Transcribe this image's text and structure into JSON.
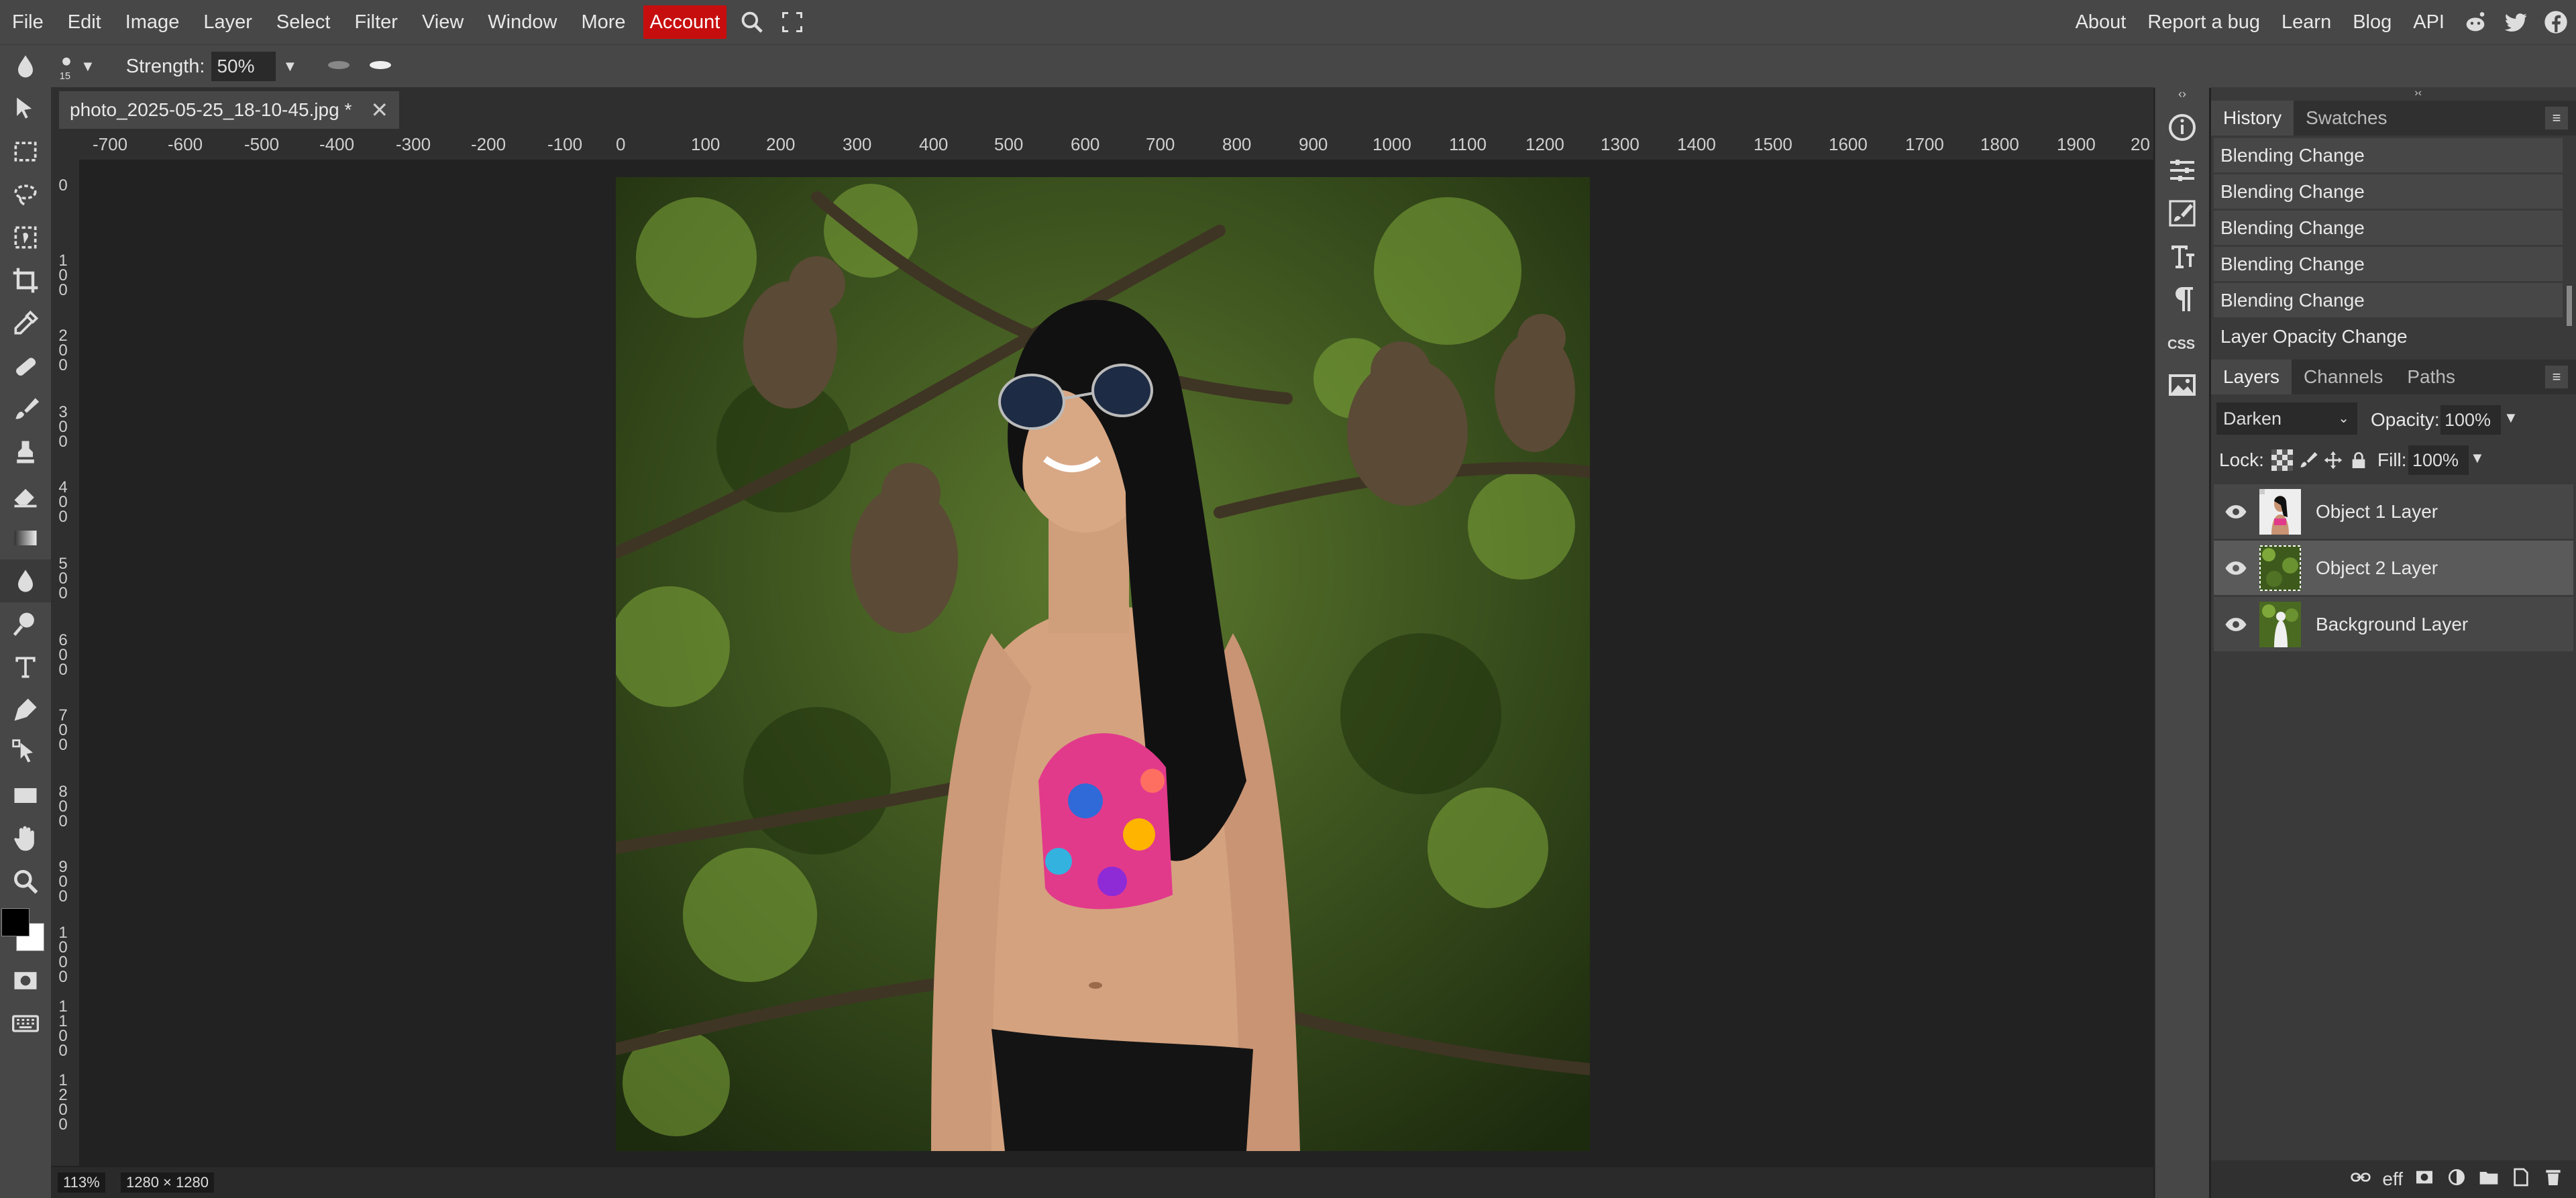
{
  "menu": {
    "items": [
      "File",
      "Edit",
      "Image",
      "Layer",
      "Select",
      "Filter",
      "View",
      "Window",
      "More"
    ],
    "account": "Account",
    "right_links": [
      "About",
      "Report a bug",
      "Learn",
      "Blog",
      "API"
    ]
  },
  "options": {
    "brush_size": "15",
    "strength_label": "Strength:",
    "strength_value": "50%"
  },
  "document": {
    "tab_title": "photo_2025-05-25_18-10-45.jpg *",
    "close": "✕"
  },
  "ruler": {
    "h_ticks": [
      "-700",
      "-600",
      "-500",
      "-400",
      "-300",
      "-200",
      "-100",
      "0",
      "100",
      "200",
      "300",
      "400",
      "500",
      "600",
      "700",
      "800",
      "900",
      "1000",
      "1100",
      "1200",
      "1300",
      "1400",
      "1500",
      "1600",
      "1700",
      "1800",
      "1900",
      "20"
    ],
    "v_ticks": [
      "0",
      "100",
      "200",
      "300",
      "400",
      "500",
      "600",
      "700",
      "800",
      "900",
      "1000",
      "1100",
      "1200"
    ]
  },
  "status": {
    "zoom": "113%",
    "size": "1280 × 1280"
  },
  "history": {
    "tabs": [
      "History",
      "Swatches"
    ],
    "items": [
      "Blending Change",
      "Blending Change",
      "Blending Change",
      "Blending Change",
      "Blending Change",
      "Layer Opacity Change"
    ]
  },
  "layers": {
    "tabs": [
      "Layers",
      "Channels",
      "Paths"
    ],
    "blend_mode": "Darken",
    "opacity_label": "Opacity:",
    "opacity_value": "100%",
    "lock_label": "Lock:",
    "fill_label": "Fill:",
    "fill_value": "100%",
    "items": [
      "Object 1 Layer",
      "Object 2 Layer",
      "Background Layer"
    ],
    "footer_text": "eff"
  },
  "colors": {
    "accent_account": "#c70e0e",
    "foreground": "#000000",
    "background": "#ffffff"
  }
}
